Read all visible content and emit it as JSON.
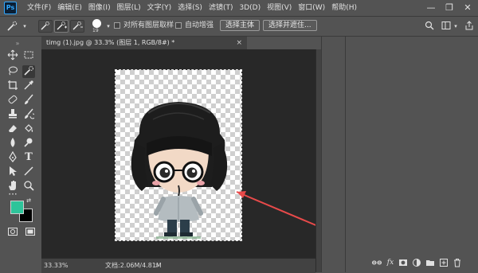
{
  "app": {
    "logo_text": "Ps"
  },
  "menu": {
    "items": [
      {
        "label": "文件(F)"
      },
      {
        "label": "编辑(E)"
      },
      {
        "label": "图像(I)"
      },
      {
        "label": "图层(L)"
      },
      {
        "label": "文字(Y)"
      },
      {
        "label": "选择(S)"
      },
      {
        "label": "滤镜(T)"
      },
      {
        "label": "3D(D)"
      },
      {
        "label": "视图(V)"
      },
      {
        "label": "窗口(W)"
      },
      {
        "label": "帮助(H)"
      }
    ],
    "window_controls": {
      "minimize": "—",
      "restore": "❐",
      "close": "✕"
    }
  },
  "options": {
    "brush_size": "19",
    "sample_all_layers": "对所有图层取样",
    "auto_enhance": "自动增强",
    "select_subject": "选择主体",
    "select_and_mask": "选择并遮住..."
  },
  "document": {
    "tab_title": "timg (1).jpg @ 33.3% (图层 1, RGB/8#) *",
    "tab_close": "×"
  },
  "status": {
    "zoom": "33.33%",
    "doc_size": "文档:2.06M/4.81M",
    "arrow": ">"
  },
  "colors": {
    "foreground": "#2ec49a",
    "background": "#000000",
    "annotation_arrow": "#e84a4a"
  },
  "icons": {
    "quick_selection_tool": "quick-selection-icon",
    "search": "search-icon",
    "workspace": "workspace-icon",
    "share": "share-icon"
  }
}
